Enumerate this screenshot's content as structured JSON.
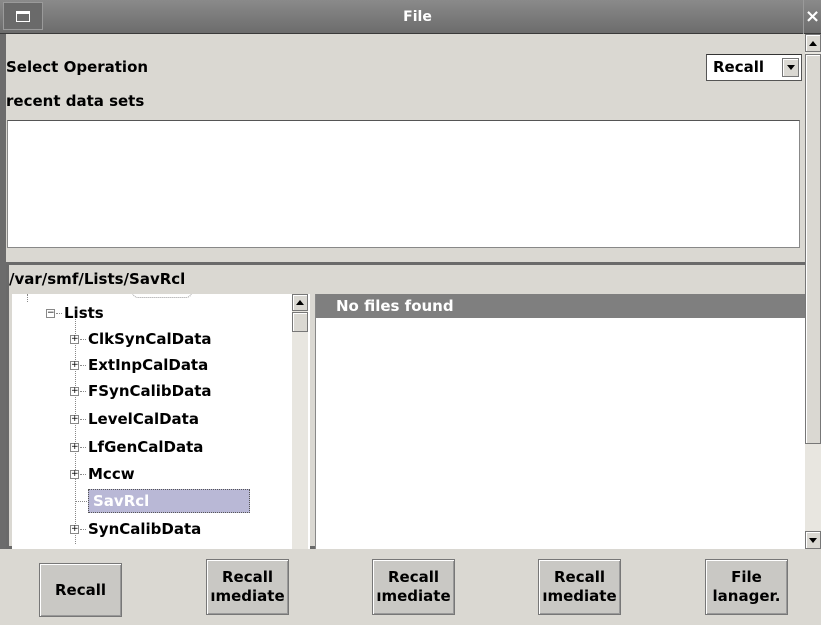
{
  "window": {
    "title": "File",
    "close_glyph": "×"
  },
  "top": {
    "select_operation_label": "Select Operation",
    "operation_value": "Recall",
    "recent_label": "recent data sets"
  },
  "browser": {
    "path": "/var/smf/Lists/SavRcl",
    "tree": [
      {
        "label": "Lists",
        "expander": "−"
      },
      {
        "label": "ClkSynCalData",
        "expander": "+"
      },
      {
        "label": "ExtInpCalData",
        "expander": "+"
      },
      {
        "label": "FSynCalibData",
        "expander": "+"
      },
      {
        "label": "LevelCalData",
        "expander": "+"
      },
      {
        "label": "LfGenCalData",
        "expander": "+"
      },
      {
        "label": "Mccw",
        "expander": "+"
      },
      {
        "label": "SavRcl",
        "expander": ""
      },
      {
        "label": "SynCalibData",
        "expander": "+"
      }
    ],
    "files_message": "No files found"
  },
  "buttons": {
    "recall": "Recall",
    "recall_immediate_1_top": "Recall",
    "recall_immediate_1_bottom": "ımediate",
    "recall_immediate_2_top": "Recall",
    "recall_immediate_2_bottom": "ımediate",
    "recall_immediate_3_top": "Recall",
    "recall_immediate_3_bottom": "ımediate",
    "file_manager_top": "File",
    "file_manager_bottom": "lanager."
  },
  "colors": {
    "background": "#dad8d2",
    "titlebar": "#7a7a7a",
    "files_header": "#7f7f7f",
    "selection": "#b9b8d6"
  }
}
